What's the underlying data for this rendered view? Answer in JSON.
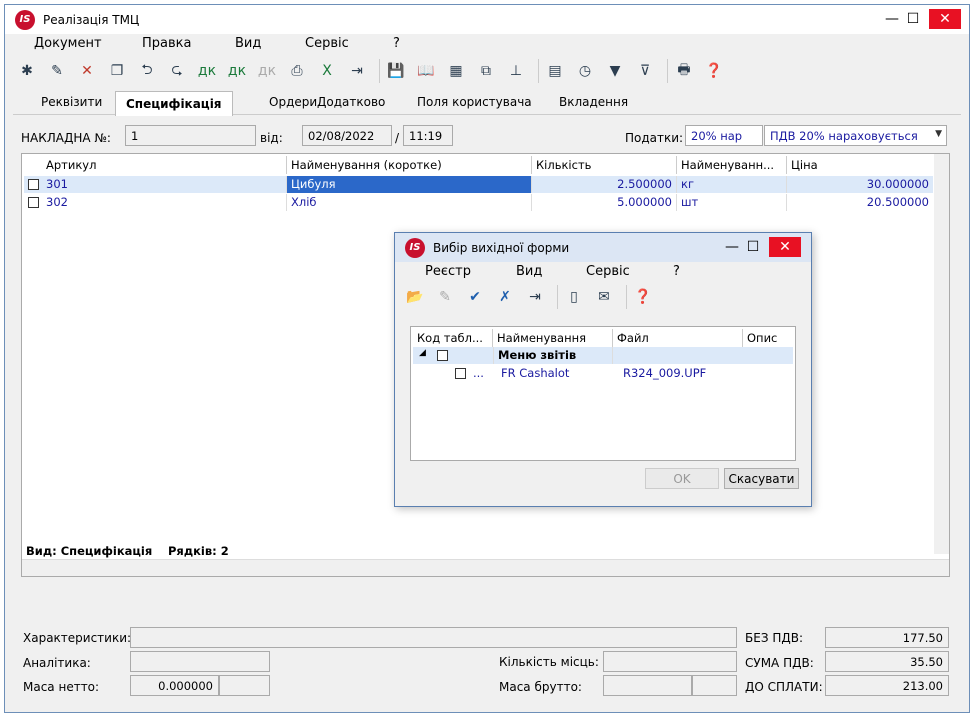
{
  "window": {
    "title": "Реалізація ТМЦ"
  },
  "menu": [
    "Документ",
    "Правка",
    "Вид",
    "Сервіс",
    "?"
  ],
  "tabs": [
    "Реквізити",
    "Специфікація",
    "Ордери",
    "Додатково",
    "Поля користувача",
    "Вкладення"
  ],
  "form": {
    "invoice_label": "НАКЛАДНА №:",
    "invoice_no": "1",
    "from_label": "від:",
    "date": "02/08/2022",
    "slash": "/",
    "time": "11:19",
    "taxes_label": "Податки:",
    "tax_rate": "20% нар",
    "tax_desc": "ПДВ 20% нараховується"
  },
  "table": {
    "columns": [
      "Артикул",
      "Найменування (коротке)",
      "Кількість",
      "Найменуванн...",
      "Ціна"
    ],
    "rows": [
      {
        "sku": "301",
        "name": "Цибуля",
        "qty": "2.500000",
        "unit": "кг",
        "price": "30.000000"
      },
      {
        "sku": "302",
        "name": "Хліб",
        "qty": "5.000000",
        "unit": "шт",
        "price": "20.500000"
      }
    ]
  },
  "status": {
    "view": "Вид: Специфікація",
    "rows": "Рядків: 2"
  },
  "bottom": {
    "characteristics": "Характеристики:",
    "analytics": "Аналітика:",
    "net_mass_label": "Маса нетто:",
    "net_mass": "0.000000",
    "places_label": "Кількість місць:",
    "gross_label": "Маса брутто:",
    "no_vat_label": "БЕЗ ПДВ:",
    "no_vat": "177.50",
    "vat_sum_label": "СУМА ПДВ:",
    "vat_sum": "35.50",
    "total_label": "ДО СПЛАТИ:",
    "total": "213.00"
  },
  "dialog": {
    "title": "Вибір вихідної форми",
    "menu": [
      "Реєстр",
      "Вид",
      "Сервіс",
      "?"
    ],
    "columns": [
      "Код табл...",
      "Найменування",
      "Файл",
      "Опис"
    ],
    "group": "Меню звітів",
    "item_code": "...",
    "item_name": "FR Cashalot",
    "item_file": "R324_009.UPF",
    "ok": "OK",
    "cancel": "Скасувати"
  },
  "logo_text": "IS"
}
